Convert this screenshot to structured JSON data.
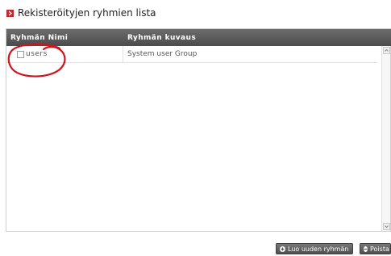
{
  "page": {
    "title": "Rekisteröityjen ryhmien lista",
    "title_icon": "arrow-right-icon",
    "accent_color": "#c0282d"
  },
  "grid": {
    "columns": [
      "Ryhmän Nimi",
      "Ryhmän kuvaus"
    ],
    "rows": [
      {
        "name": "users",
        "description": "System user Group",
        "checked": false
      }
    ],
    "annotation_color": "#d0141c"
  },
  "actions": {
    "create_label": "Luo uuden ryhmän",
    "create_icon": "plus-circle-icon",
    "delete_label": "Poista",
    "delete_icon": "minus-circle-icon"
  }
}
